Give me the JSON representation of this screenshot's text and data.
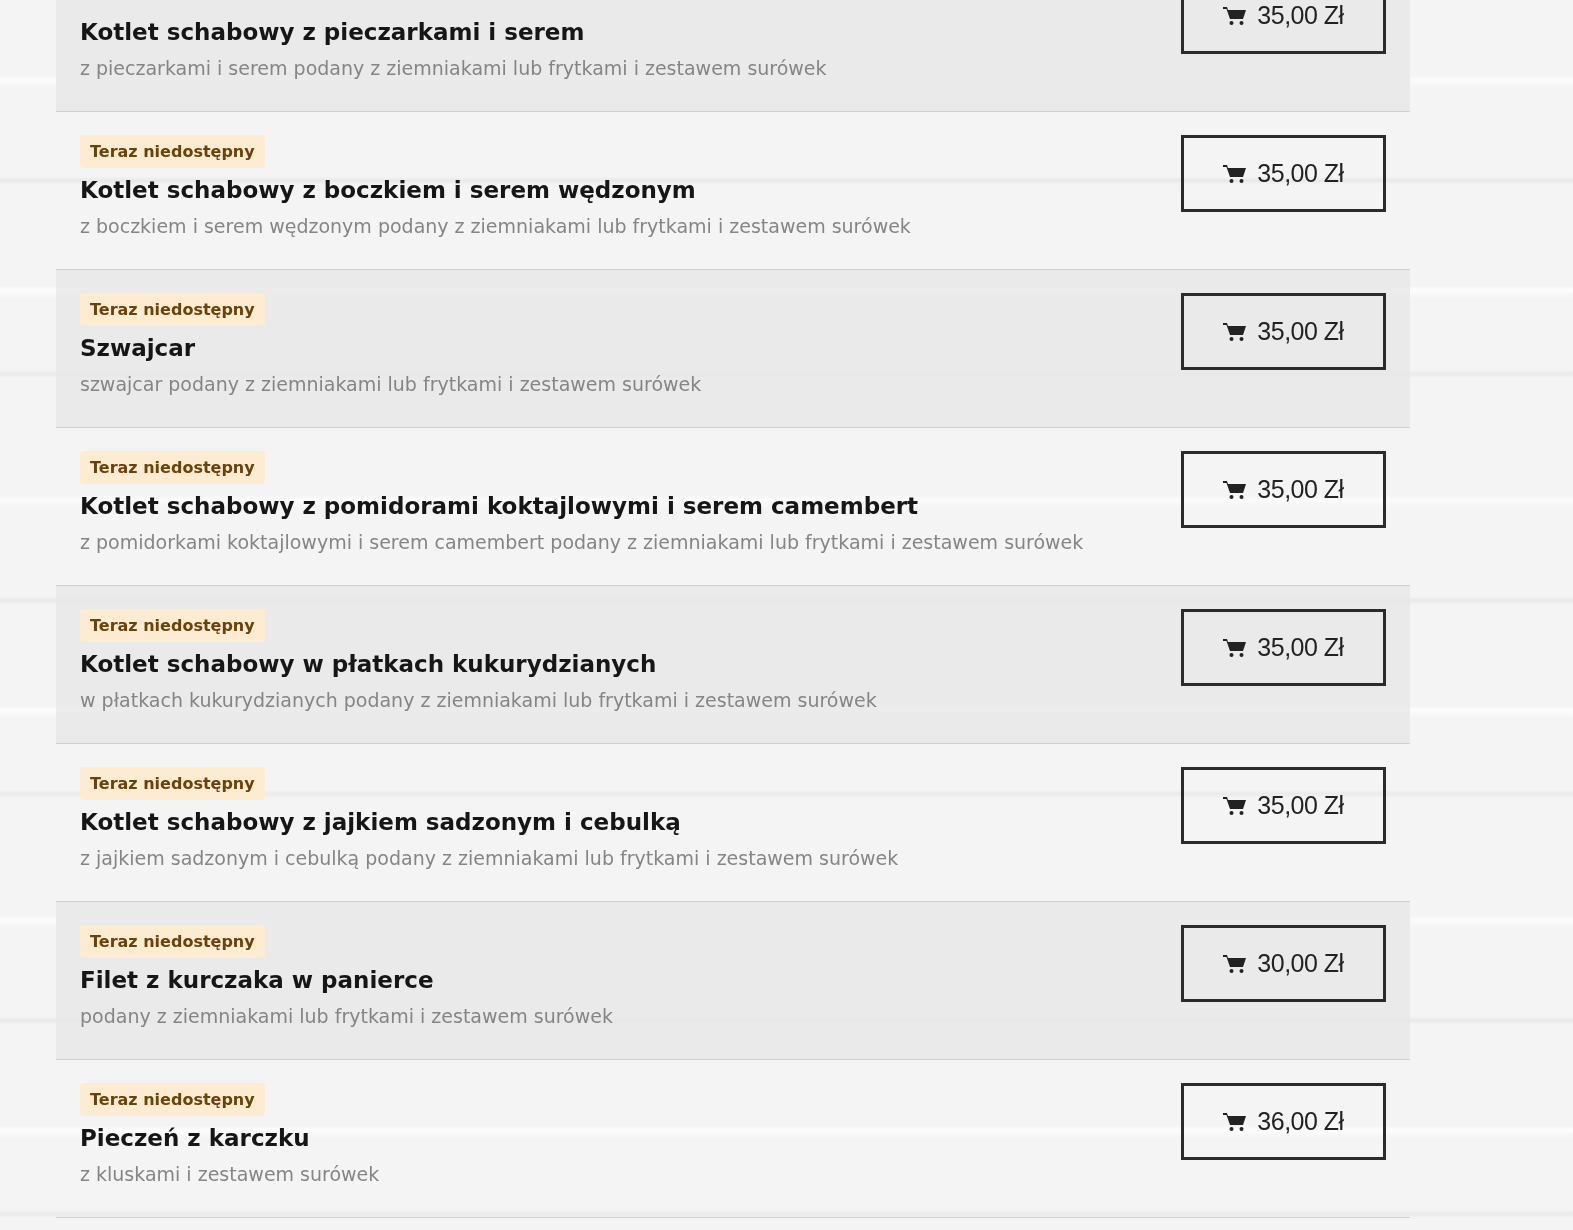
{
  "menu_items": [
    {
      "title": "Kotlet schabowy z pieczarkami i serem",
      "description": "z pieczarkami i serem podany z ziemniakami lub frytkami i zestawem surówek",
      "price": "35,00 Zł"
    },
    {
      "badge": "Teraz niedostępny",
      "title": "Kotlet schabowy z boczkiem i serem wędzonym",
      "description": "z boczkiem i serem wędzonym podany z ziemniakami lub frytkami i zestawem surówek",
      "price": "35,00 Zł"
    },
    {
      "badge": "Teraz niedostępny",
      "title": "Szwajcar",
      "description": "szwajcar podany z ziemniakami lub frytkami i zestawem surówek",
      "price": "35,00 Zł"
    },
    {
      "badge": "Teraz niedostępny",
      "title": "Kotlet schabowy z pomidorami koktajlowymi i serem camembert",
      "description": "z pomidorkami koktajlowymi i serem camembert podany z ziemniakami lub frytkami i zestawem surówek",
      "price": "35,00 Zł"
    },
    {
      "badge": "Teraz niedostępny",
      "title": "Kotlet schabowy w płatkach kukurydzianych",
      "description": "w płatkach kukurydzianych podany z ziemniakami lub frytkami i zestawem surówek",
      "price": "35,00 Zł"
    },
    {
      "badge": "Teraz niedostępny",
      "title": "Kotlet schabowy z jajkiem sadzonym i cebulką",
      "description": "z jajkiem sadzonym i cebulką podany z ziemniakami lub frytkami i zestawem surówek",
      "price": "35,00 Zł"
    },
    {
      "badge": "Teraz niedostępny",
      "title": "Filet z kurczaka w panierce",
      "description": "podany z ziemniakami lub frytkami i zestawem surówek",
      "price": "30,00 Zł"
    },
    {
      "badge": "Teraz niedostępny",
      "title": "Pieczeń z karczku",
      "description": "z kluskami i zestawem surówek",
      "price": "36,00 Zł"
    }
  ]
}
